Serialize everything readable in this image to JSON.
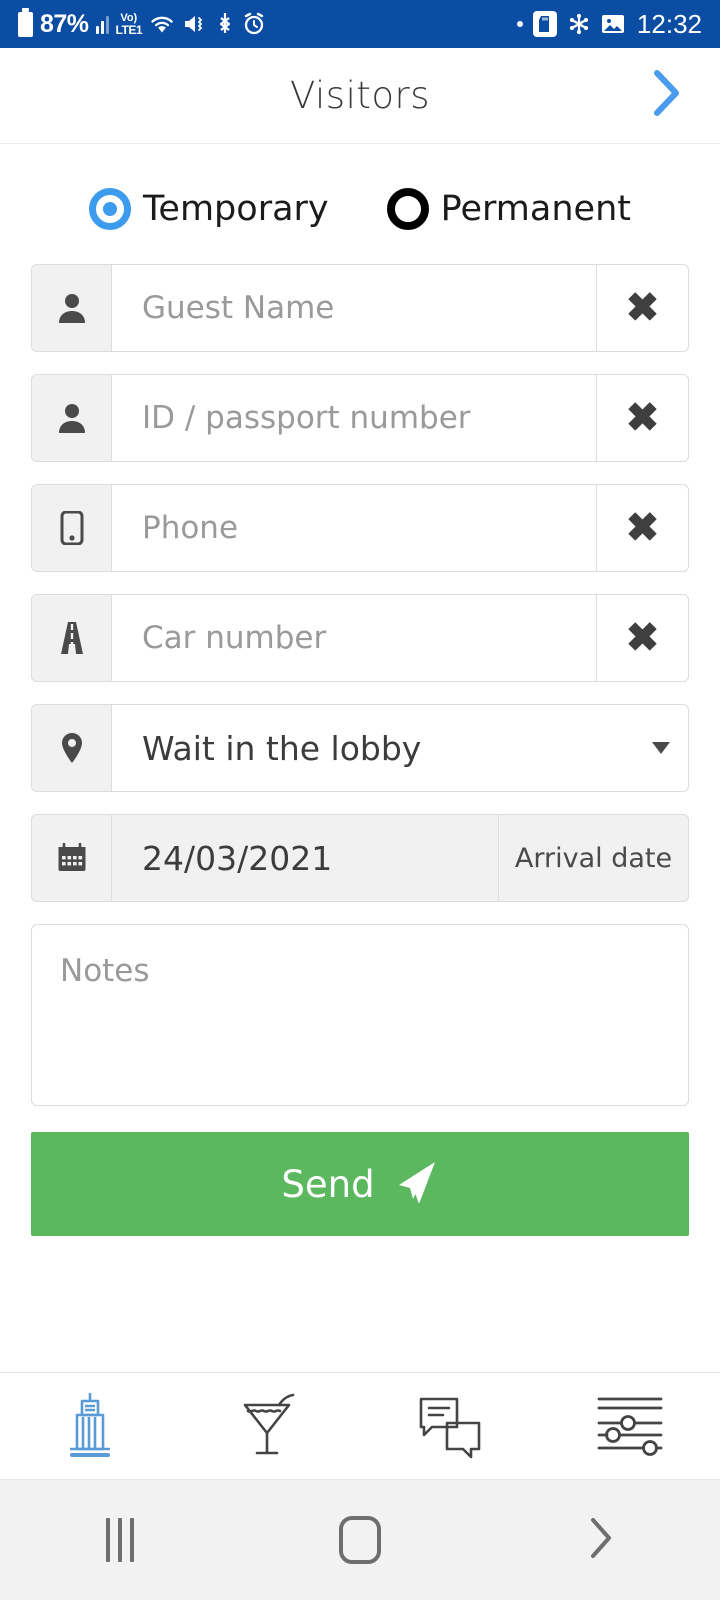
{
  "statusbar": {
    "battery_percent": "87%",
    "network_label_top": "Vo)",
    "network_label_bottom": "LTE1",
    "clock": "12:32",
    "icons_left": [
      "battery-icon",
      "signal-bars-icon",
      "volte-icon",
      "wifi-icon",
      "mute-vibrate-icon",
      "bluetooth-icon",
      "alarm-icon"
    ],
    "icons_right": [
      "dot-icon",
      "sd-card-icon",
      "snowflake-icon",
      "image-icon"
    ],
    "background": "#0b4da2"
  },
  "header": {
    "title": "Visitors",
    "next_icon": "chevron-right-icon",
    "next_color": "#4a9bed"
  },
  "visitor_type": {
    "options": [
      {
        "label": "Temporary",
        "selected": true
      },
      {
        "label": "Permanent",
        "selected": false
      }
    ],
    "selected_color": "#3d9bee",
    "unselected_color": "#000000"
  },
  "form": {
    "fields": [
      {
        "icon": "person-icon",
        "placeholder": "Guest Name",
        "value": "",
        "clear_label": "✖"
      },
      {
        "icon": "person-icon",
        "placeholder": "ID / passport number",
        "value": "",
        "clear_label": "✖"
      },
      {
        "icon": "mobile-phone-icon",
        "placeholder": "Phone",
        "value": "",
        "clear_label": "✖"
      },
      {
        "icon": "road-icon",
        "placeholder": "Car number",
        "value": "",
        "clear_label": "✖"
      }
    ],
    "location_select": {
      "icon": "map-pin-icon",
      "value": "Wait in the lobby",
      "caret": "caret-down-icon"
    },
    "arrival_date": {
      "icon": "calendar-icon",
      "value": "24/03/2021",
      "label": "Arrival date"
    },
    "notes": {
      "placeholder": "Notes",
      "value": ""
    },
    "send": {
      "label": "Send",
      "icon": "paper-plane-icon",
      "color": "#5cb85f"
    }
  },
  "tabbar": {
    "active_color": "#5a9bd5",
    "inactive_color": "#444444",
    "tabs": [
      {
        "name": "building-icon",
        "active": true
      },
      {
        "name": "cocktail-icon",
        "active": false
      },
      {
        "name": "chat-bubbles-icon",
        "active": false
      },
      {
        "name": "sliders-icon",
        "active": false
      }
    ]
  },
  "sysnav": {
    "recents": "recents-icon",
    "home": "home-icon",
    "back": "back-icon"
  }
}
